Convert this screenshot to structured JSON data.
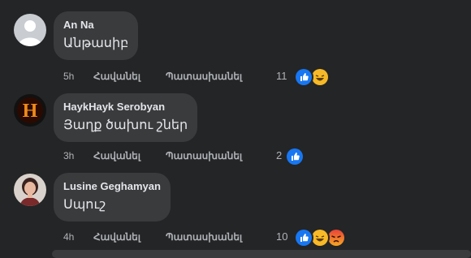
{
  "comments": [
    {
      "author": "An Na",
      "text": "Անթասիբ",
      "time": "5h",
      "like_label": "Հավանել",
      "reply_label": "Պատասխանել",
      "reaction_count": "11",
      "reactions": [
        "like-icon",
        "haha-icon"
      ]
    },
    {
      "author": "HaykHayk Serobyan",
      "text": "Յաղք ծախու շներ",
      "time": "3h",
      "like_label": "Հավանել",
      "reply_label": "Պատասխանել",
      "reaction_count": "2",
      "reactions": [
        "like-icon"
      ]
    },
    {
      "author": "Lusine Geghamyan",
      "text": "Սպուշ",
      "time": "4h",
      "like_label": "Հավանել",
      "reply_label": "Պատասխանել",
      "reaction_count": "10",
      "reactions": [
        "like-icon",
        "haha-icon",
        "angry-icon"
      ]
    }
  ],
  "colors": {
    "background": "#242526",
    "bubble": "#3a3b3c",
    "text": "#e4e6eb",
    "secondary_text": "#b0b3b8",
    "like_blue": "#1877f2",
    "haha_yellow": "#f7b928",
    "angry_red": "#e9710f"
  }
}
